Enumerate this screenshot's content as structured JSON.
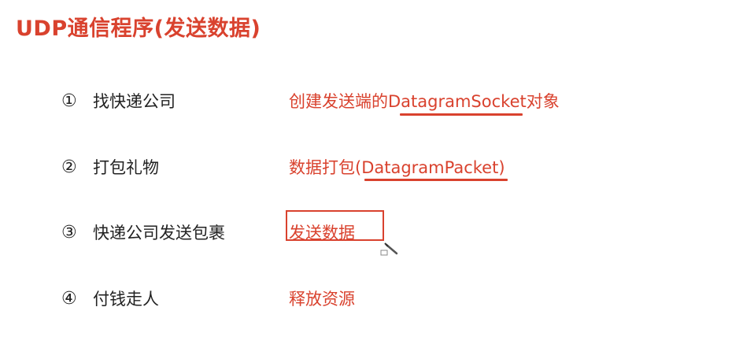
{
  "slide": {
    "title": "UDP通信程序(发送数据)"
  },
  "steps": [
    {
      "num": "①",
      "label": "找快递公司",
      "action": "创建发送端的DatagramSocket对象"
    },
    {
      "num": "②",
      "label": "打包礼物",
      "action": "数据打包(DatagramPacket)"
    },
    {
      "num": "③",
      "label": "快递公司发送包裹",
      "action": "发送数据"
    },
    {
      "num": "④",
      "label": "付钱走人",
      "action": "释放资源"
    }
  ],
  "colors": {
    "accent": "#d9422e",
    "text": "#222222"
  },
  "icons": {
    "annotation_cursor": "pen-cursor-icon"
  }
}
